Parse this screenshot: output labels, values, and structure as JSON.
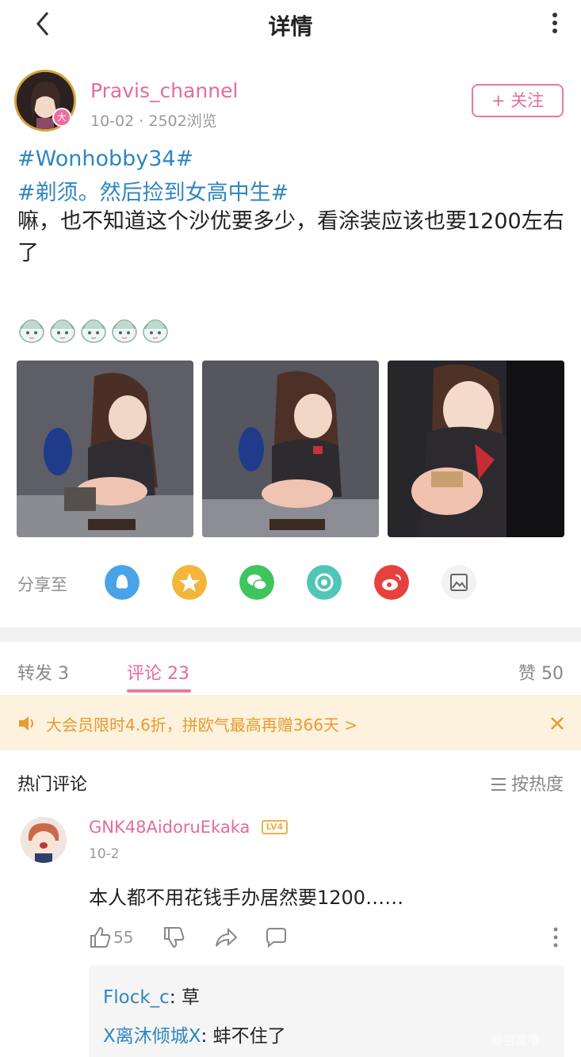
{
  "header": {
    "title": "详情",
    "back_icon": "chevron-left-icon",
    "more_icon": "vertical-dots-icon"
  },
  "author": {
    "name": "Pravis_channel",
    "date": "10-02",
    "views": "2502浏览",
    "badge": "大",
    "follow_label": "+ 关注"
  },
  "post": {
    "tags": [
      "#Wonhobby34#",
      "#剃须。然后捡到女高中生#"
    ],
    "text": "嘛，也不知道这个沙优要多少，看涂装应该也要1200左右了",
    "emoji_count": 5,
    "photos": [
      "photo-1",
      "photo-2",
      "photo-3"
    ]
  },
  "share": {
    "label": "分享至",
    "targets": [
      {
        "name": "qq",
        "color": "#4aa3e8"
      },
      {
        "name": "qzone",
        "color": "#f3b63a"
      },
      {
        "name": "wechat",
        "color": "#3fc55d"
      },
      {
        "name": "moments",
        "color": "#4fc6b7"
      },
      {
        "name": "weibo",
        "color": "#e6413d"
      },
      {
        "name": "image",
        "color": "#f2f2f2"
      }
    ]
  },
  "tabs": {
    "repost": "转发 3",
    "comments": "评论 23",
    "likes": "赞 50"
  },
  "promo": {
    "text": "大会员限时4.6折，拼欧气最高再赠366天 >"
  },
  "comments_section": {
    "title": "热门评论",
    "sort_label": "按热度"
  },
  "comment": {
    "user": "GNK48AidoruEkaka",
    "level": "LV4",
    "date": "10-2",
    "text": "本人都不用花钱手办居然要1200……",
    "likes": "55",
    "replies": [
      {
        "name": "Flock_c",
        "text": ": 草"
      },
      {
        "name": "X离沐倾城X",
        "text": ": 蚌不住了"
      }
    ]
  },
  "watermark": "@宫凌噜",
  "colors": {
    "accent": "#e46b9d",
    "link": "#2f86c2",
    "promo": "#e89a2c"
  }
}
